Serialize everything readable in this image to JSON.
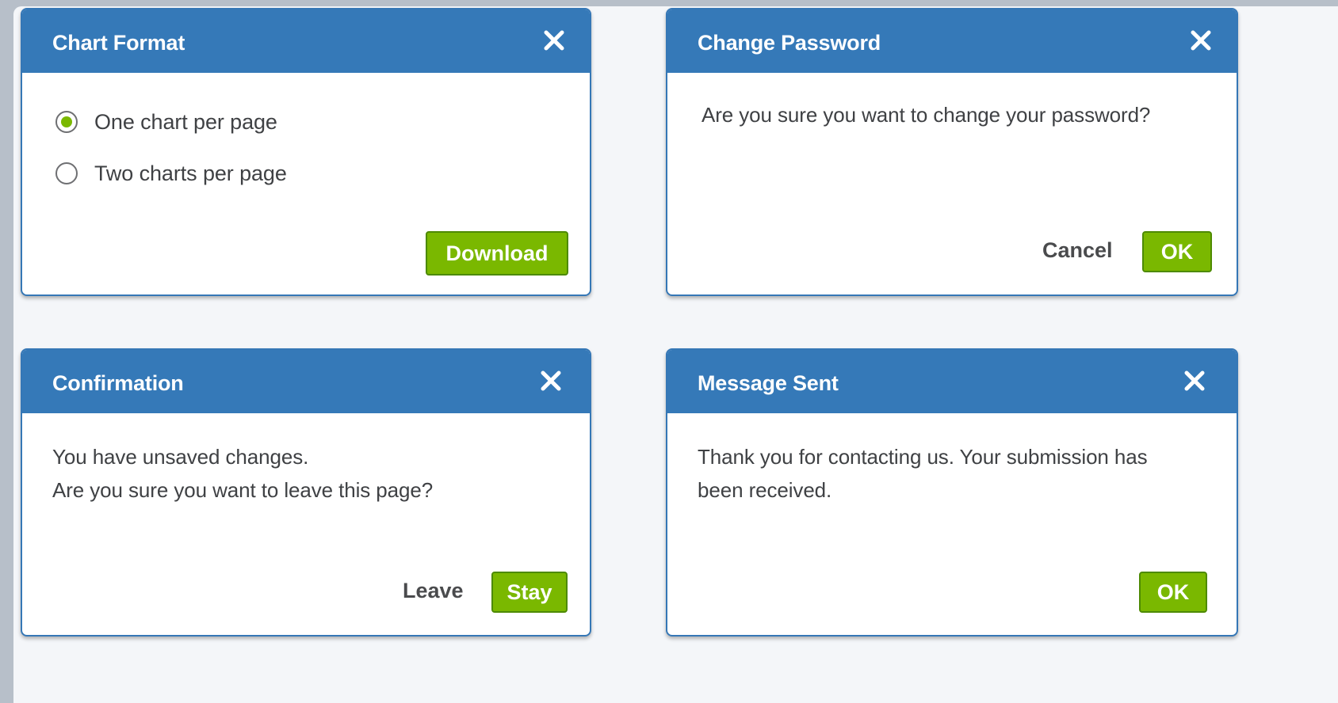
{
  "dialogs": {
    "chart_format": {
      "title": "Chart Format",
      "options": [
        {
          "label": "One chart per page",
          "selected": true
        },
        {
          "label": "Two charts per page",
          "selected": false
        }
      ],
      "download_label": "Download"
    },
    "change_password": {
      "title": "Change Password",
      "message": "Are you sure you want to change your password?",
      "cancel_label": "Cancel",
      "ok_label": "OK"
    },
    "confirmation": {
      "title": "Confirmation",
      "message_line1": "You have unsaved changes.",
      "message_line2": "Are you sure you want to leave this page?",
      "leave_label": "Leave",
      "stay_label": "Stay"
    },
    "message_sent": {
      "title": "Message Sent",
      "message_line1": "Thank you for contacting us. Your submission has",
      "message_line2": "been received.",
      "ok_label": "OK"
    }
  },
  "icons": {
    "close": "close-icon",
    "radio_selected": "radio-selected-icon",
    "radio_unselected": "radio-unselected-icon"
  },
  "colors": {
    "header_blue": "#3579b8",
    "accent_green": "#7ab800",
    "text_gray": "#3f4144"
  }
}
